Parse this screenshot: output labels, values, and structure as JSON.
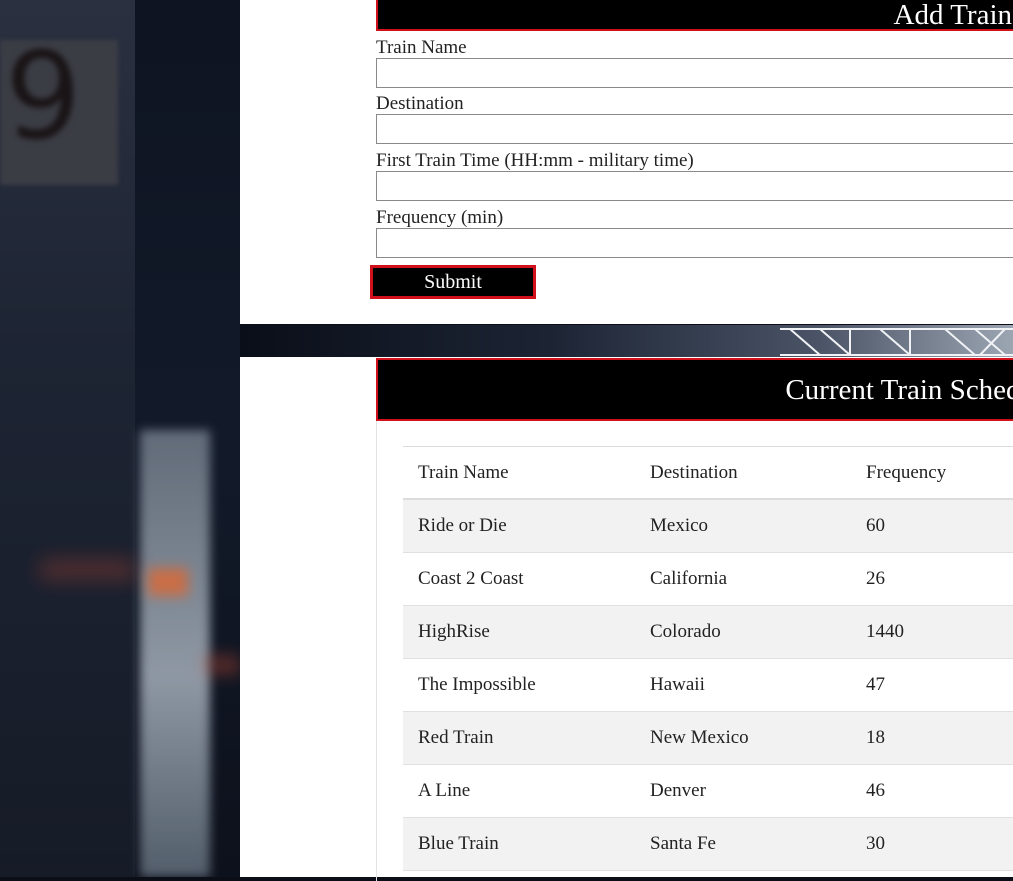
{
  "form": {
    "header": "Add Train",
    "fields": [
      {
        "label": "Train Name",
        "value": ""
      },
      {
        "label": "Destination",
        "value": ""
      },
      {
        "label": "First Train Time (HH:mm - military time)",
        "value": ""
      },
      {
        "label": "Frequency (min)",
        "value": ""
      }
    ],
    "submit_label": "Submit"
  },
  "schedule": {
    "header": "Current Train Schedule",
    "columns": [
      "Train Name",
      "Destination",
      "Frequency"
    ],
    "rows": [
      [
        "Ride or Die",
        "Mexico",
        "60"
      ],
      [
        "Coast 2 Coast",
        "California",
        "26"
      ],
      [
        "HighRise",
        "Colorado",
        "1440"
      ],
      [
        "The Impossible",
        "Hawaii",
        "47"
      ],
      [
        "Red Train",
        "New Mexico",
        "18"
      ],
      [
        "A Line",
        "Denver",
        "46"
      ],
      [
        "Blue Train",
        "Santa Fe",
        "30"
      ]
    ]
  },
  "colors": {
    "header_bg": "#000000",
    "accent_border": "#d0111b",
    "stripe_row": "#f2f2f2"
  }
}
